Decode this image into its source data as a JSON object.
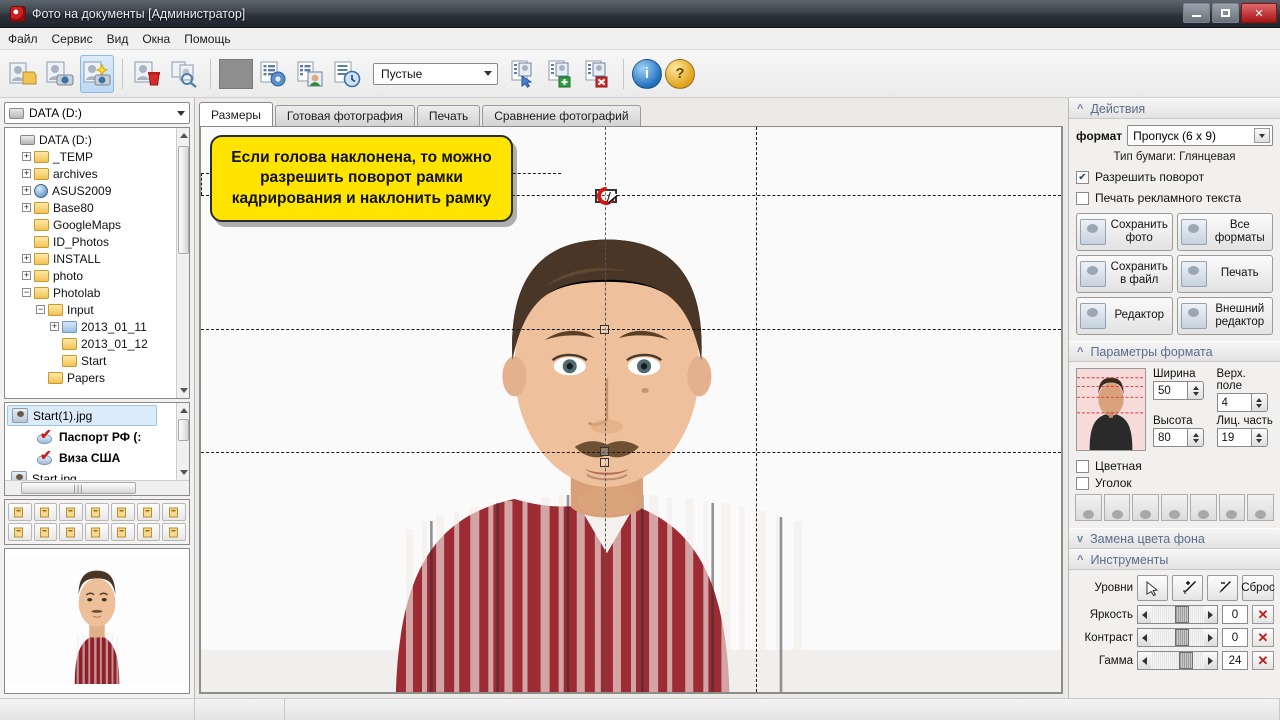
{
  "window": {
    "title": "Фото на документы  [Администратор]",
    "icon": "app-icon",
    "minimize": "–",
    "maximize": "□",
    "close": "✕"
  },
  "menu": {
    "items": [
      "Файл",
      "Сервис",
      "Вид",
      "Окна",
      "Помощь"
    ]
  },
  "toolbar": {
    "icons": [
      "open-photo-icon",
      "camera-photo-icon",
      "new-photo-icon",
      "delete-photo-icon",
      "find-photo-icon",
      "gray-placeholder",
      "settings-list-icon",
      "person-list-icon",
      "history-list-icon",
      "select-list-icon",
      "add-list-icon",
      "remove-list-icon"
    ],
    "combo_value": "Пустые",
    "info_label": "i",
    "help_label": "?"
  },
  "left_panel": {
    "drive_combo": {
      "value": "DATA (D:)",
      "icon": "drive-icon"
    },
    "tree": [
      {
        "label": "DATA (D:)",
        "indent": 0,
        "expander": "",
        "icon": "drive-icon"
      },
      {
        "label": "_TEMP",
        "indent": 1,
        "expander": "+",
        "icon": "folder-icon"
      },
      {
        "label": "archives",
        "indent": 1,
        "expander": "+",
        "icon": "folder-icon"
      },
      {
        "label": "ASUS2009",
        "indent": 1,
        "expander": "+",
        "icon": "globe-icon"
      },
      {
        "label": "Base80",
        "indent": 1,
        "expander": "+",
        "icon": "folder-icon"
      },
      {
        "label": "GoogleMaps",
        "indent": 1,
        "expander": "",
        "icon": "folder-icon"
      },
      {
        "label": "ID_Photos",
        "indent": 1,
        "expander": "",
        "icon": "folder-icon"
      },
      {
        "label": "INSTALL",
        "indent": 1,
        "expander": "+",
        "icon": "folder-icon"
      },
      {
        "label": "photo",
        "indent": 1,
        "expander": "+",
        "icon": "folder-icon"
      },
      {
        "label": "Photolab",
        "indent": 1,
        "expander": "−",
        "icon": "folder-icon"
      },
      {
        "label": "Input",
        "indent": 2,
        "expander": "−",
        "icon": "folder-icon"
      },
      {
        "label": "2013_01_11",
        "indent": 3,
        "expander": "+",
        "icon": "folder-icon-selected"
      },
      {
        "label": "2013_01_12",
        "indent": 3,
        "expander": "",
        "icon": "folder-icon"
      },
      {
        "label": "Start",
        "indent": 3,
        "expander": "",
        "icon": "folder-icon"
      },
      {
        "label": "Papers",
        "indent": 2,
        "expander": "",
        "icon": "folder-icon"
      }
    ],
    "file_list": [
      {
        "label": "Start(1).jpg",
        "icon": "photo-item-icon",
        "selected": true,
        "bold": false,
        "indent": 0
      },
      {
        "label": "Паспорт РФ (:",
        "icon": "format-check-icon",
        "selected": false,
        "bold": true,
        "indent": 1
      },
      {
        "label": "Виза США",
        "icon": "format-check-icon",
        "selected": false,
        "bold": true,
        "indent": 1
      },
      {
        "label": "Start.jpg",
        "icon": "photo-item-icon",
        "selected": false,
        "bold": false,
        "indent": 0
      }
    ],
    "mini_tools": [
      "add-format-icon",
      "remove-format-icon",
      "open-folder-icon",
      "save-folder-icon",
      "export-folder-icon",
      "sort-az-down-icon",
      "sort-time-down-icon",
      "edit-pencil-icon",
      "rotate-left-icon",
      "rotate-right-icon",
      "delete-image-icon",
      "swap-icon",
      "sort-az-up-icon",
      "sort-time-up-icon"
    ],
    "preview_name": "photo-preview"
  },
  "center": {
    "tabs": [
      {
        "label": "Размеры",
        "active": true
      },
      {
        "label": "Готовая фотография",
        "active": false
      },
      {
        "label": "Печать",
        "active": false
      },
      {
        "label": "Сравнение фотографий",
        "active": false
      }
    ],
    "callout": "Если голова наклонена, то можно разрешить поворот рамки кадрирования и наклонить рамку",
    "cursor_icon": "rotate-cursor-icon",
    "rotate_handle_color": "#d41515"
  },
  "right_panel": {
    "actions": {
      "section_title": "Действия",
      "format_label": "формат",
      "format_value": "Пропуск (6 x 9)",
      "paper_type": "Тип бумаги:  Глянцевая",
      "checkboxes": [
        {
          "label": "Разрешить поворот",
          "checked": true
        },
        {
          "label": "Печать рекламного текста",
          "checked": false
        }
      ],
      "buttons": [
        {
          "label": "Сохранить фото",
          "icon": "save-photo-icon"
        },
        {
          "label": "Все форматы",
          "icon": "all-formats-icon"
        },
        {
          "label": "Сохранить в файл",
          "icon": "save-file-icon"
        },
        {
          "label": "Печать",
          "icon": "printer-icon"
        },
        {
          "label": "Редактор",
          "icon": "editor-icon"
        },
        {
          "label": "Внешний редактор",
          "icon": "external-editor-icon"
        }
      ]
    },
    "format_params": {
      "section_title": "Параметры формата",
      "thumb_name": "format-preview-thumb",
      "fields": [
        {
          "label": "Ширина",
          "value": "50"
        },
        {
          "label": "Верх. поле",
          "value": "4"
        },
        {
          "label": "Высота",
          "value": "80"
        },
        {
          "label": "Лиц. часть",
          "value": "19"
        }
      ],
      "checkboxes": [
        {
          "label": "Цветная",
          "checked": false
        },
        {
          "label": "Уголок",
          "checked": false
        }
      ],
      "thumb_count": 7
    },
    "background": {
      "section_title": "Замена цвета фона"
    },
    "tools": {
      "section_title": "Инструменты",
      "levels_label": "Уровни",
      "levels_buttons": [
        "cursor-arrow-icon",
        "eyedropper-plus-icon",
        "eyedropper-minus-icon"
      ],
      "reset_label": "Сброс",
      "sliders": [
        {
          "label": "Яркость",
          "value": "0",
          "pos": 45
        },
        {
          "label": "Контраст",
          "value": "0",
          "pos": 45
        },
        {
          "label": "Гамма",
          "value": "24",
          "pos": 52
        }
      ],
      "clear_icon": "clear-x-icon"
    }
  }
}
